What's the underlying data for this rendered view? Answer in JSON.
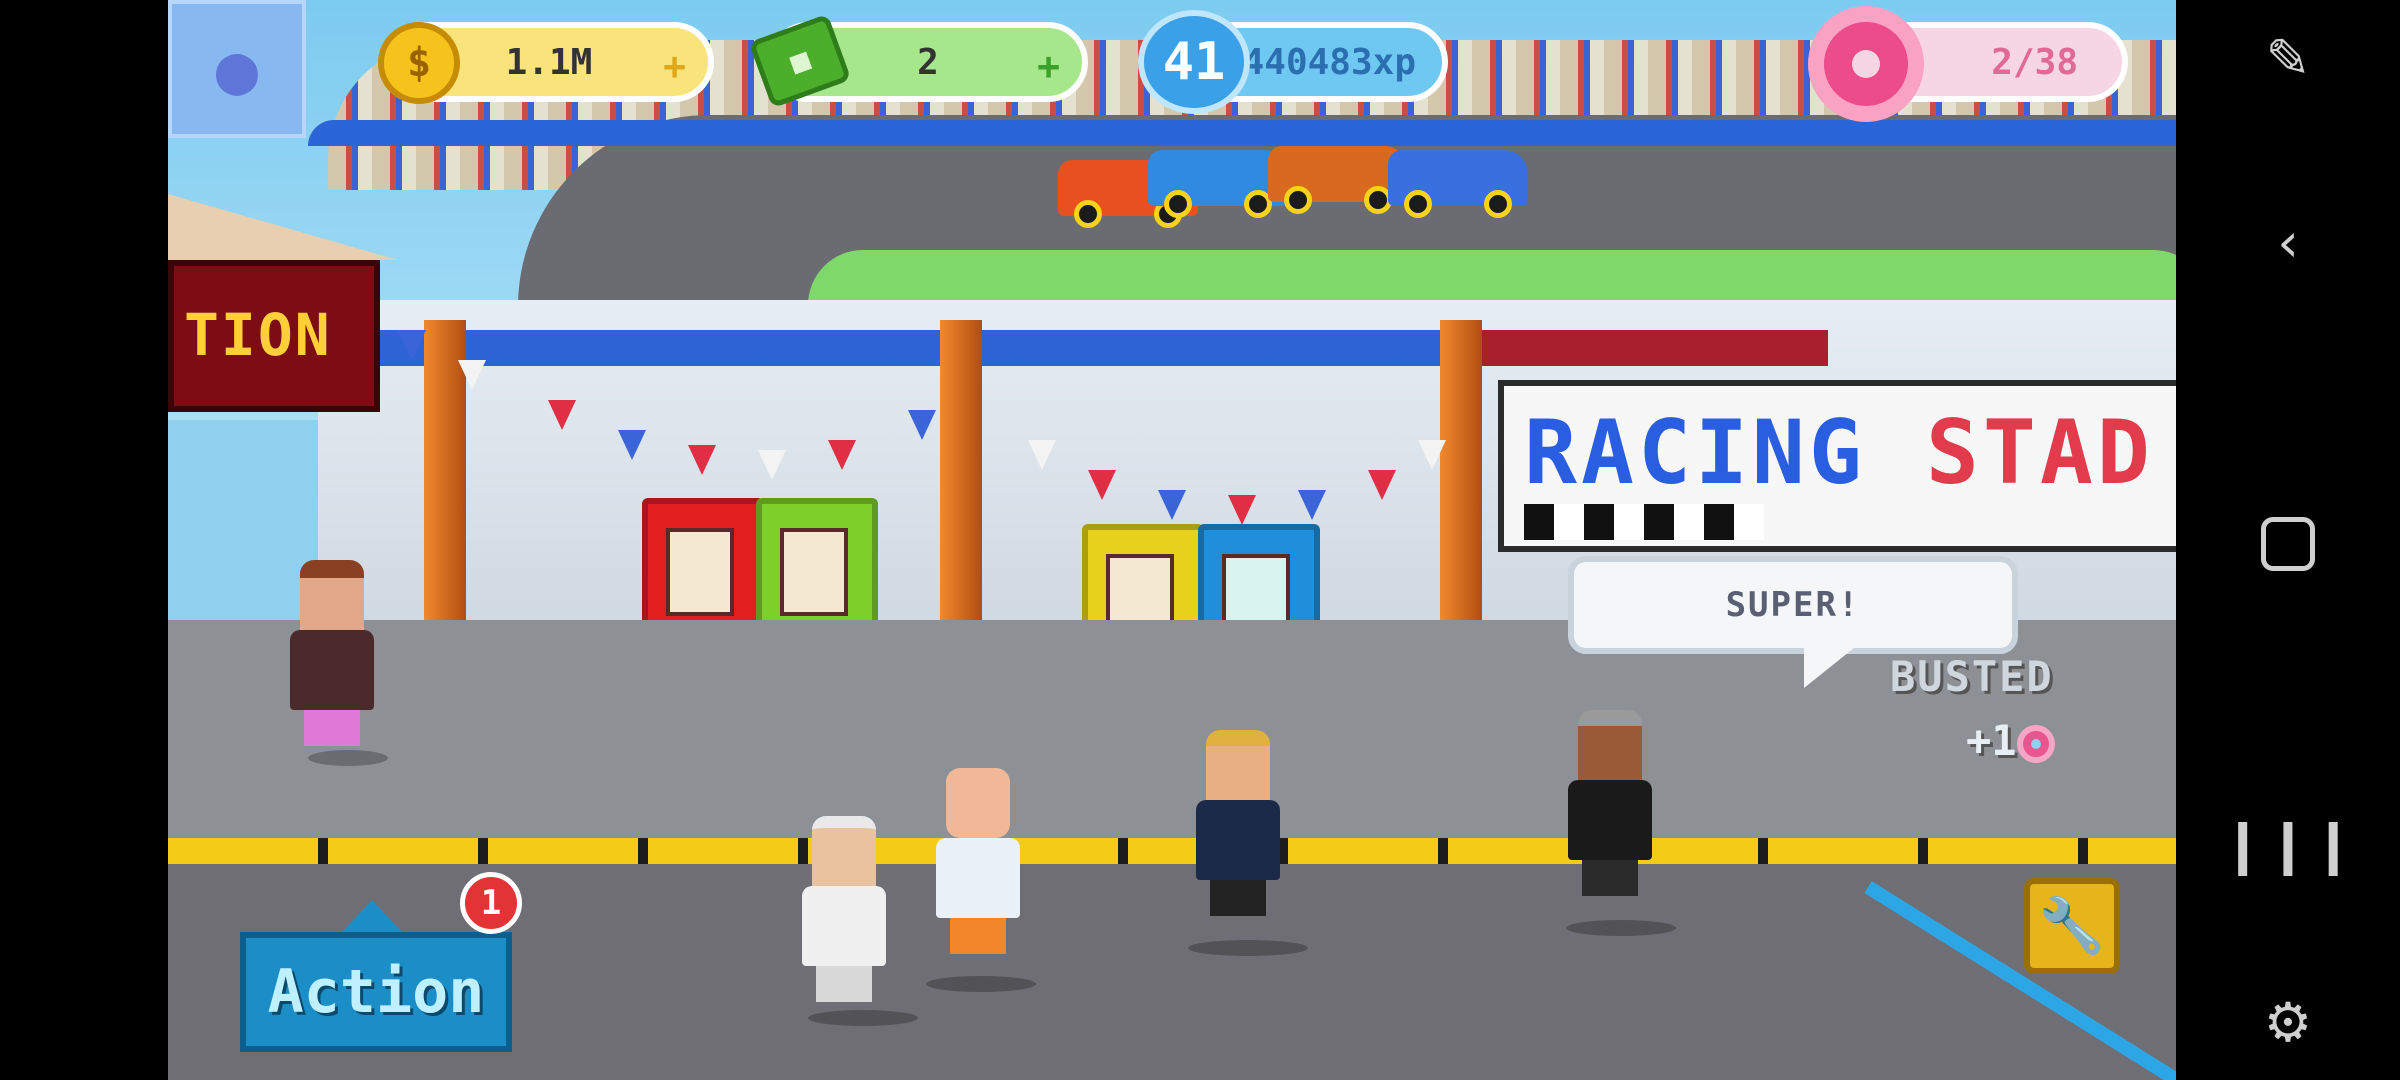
{
  "hud": {
    "coins": "1.1M",
    "cash": "2",
    "level": "41",
    "xp": "440483xp",
    "donuts": "2/38",
    "coin_icon": "$"
  },
  "scene": {
    "station_sign": "TION",
    "stadium_sign_blue": "RACING",
    "stadium_sign_red": "STAD",
    "speech_bubble": "SUPER!",
    "busted_text": "BUSTED",
    "reward_text": "+1"
  },
  "controls": {
    "action_label": "Action",
    "action_notification_count": "1"
  },
  "icons": {
    "coin": "coin-icon",
    "cash": "cash-icon",
    "level": "level-badge-icon",
    "donut": "donut-icon",
    "wrench": "wrench-icon",
    "plus": "plus-icon"
  },
  "colors": {
    "coin_pill": "#f8e47a",
    "cash_pill": "#a6e78b",
    "xp_pill": "#6fc8f2",
    "donut_pill": "#f7d6e4",
    "action_button": "#1b8ec8",
    "notification": "#e23434"
  },
  "system_nav": {
    "icons": [
      "screenshot-edit-icon",
      "back-icon",
      "home-icon",
      "recents-icon",
      "game-controller-icon"
    ]
  }
}
